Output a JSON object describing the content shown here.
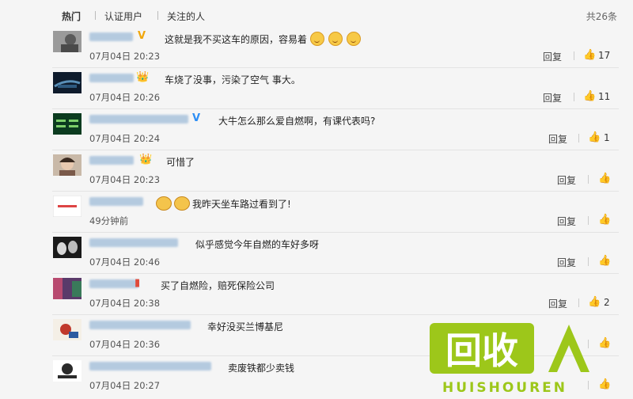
{
  "tabs": {
    "hot": "热门",
    "verified": "认证用户",
    "following": "关注的人"
  },
  "total": "共26条",
  "reply_label": "回复",
  "comments": [
    {
      "text": "这就是我不买这车的原因，容易着",
      "time": "07月04日 20:23",
      "likes": "17",
      "badge": "V"
    },
    {
      "text": "车烧了没事，污染了空气 事大。",
      "time": "07月04日 20:26",
      "likes": "11",
      "badge": "crown"
    },
    {
      "text": "大牛怎么那么爱自燃啊，有课代表吗?",
      "time": "07月04日 20:24",
      "likes": "1",
      "badge": "V"
    },
    {
      "text": "可惜了",
      "time": "07月04日 20:23",
      "likes": "",
      "badge": "crown"
    },
    {
      "text": "我昨天坐车路过看到了!",
      "time": "49分钟前",
      "likes": "",
      "badge": ""
    },
    {
      "text": "似乎感觉今年自燃的车好多呀",
      "time": "07月04日 20:46",
      "likes": "",
      "badge": ""
    },
    {
      "text": "买了自燃险，赔死保险公司",
      "time": "07月04日 20:38",
      "likes": "2",
      "badge": ""
    },
    {
      "text": "幸好没买兰博基尼",
      "time": "07月04日 20:36",
      "likes": "",
      "badge": ""
    },
    {
      "text": "卖废铁都少卖钱",
      "time": "07月04日 20:27",
      "likes": "",
      "badge": ""
    }
  ],
  "watermark": {
    "cn": "回收",
    "en": "HUISHOUREN"
  },
  "colors": {
    "accent_green": "#9dc71a",
    "vip_gold": "#f0a60b",
    "verified_blue": "#2d8ef5"
  }
}
